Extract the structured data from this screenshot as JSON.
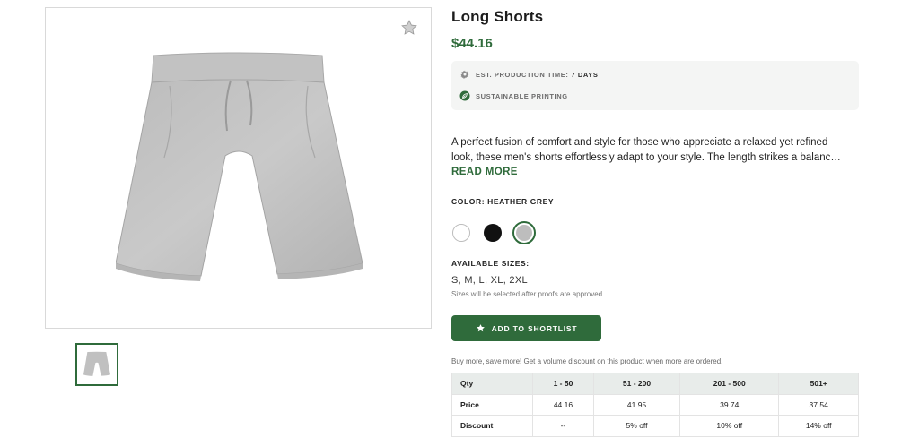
{
  "product": {
    "title": "Long Shorts",
    "price": "$44.16"
  },
  "info": {
    "production_label": "EST. PRODUCTION TIME:",
    "production_value": "7 DAYS",
    "production_icon": "gear-icon",
    "sustainable_label": "SUSTAINABLE PRINTING",
    "sustainable_icon": "leaf-icon"
  },
  "description": {
    "line1": "A perfect fusion of comfort and style for those who appreciate a relaxed yet refined",
    "line2": "look, these men's shorts effortlessly adapt to your style. The length strikes a balanc…",
    "read_more": "READ MORE"
  },
  "color": {
    "label": "COLOR: HEATHER GREY",
    "options": [
      "#ffffff",
      "#111111",
      "#bdbdbd"
    ],
    "selected_index": 2
  },
  "sizes": {
    "label": "AVAILABLE SIZES:",
    "values": "S, M, L, XL, 2XL",
    "note": "Sizes will be selected after proofs are approved"
  },
  "actions": {
    "shortlist_label": "ADD TO SHORTLIST",
    "shortlist_icon": "star-icon",
    "favorite_icon": "star-outline-icon"
  },
  "volume": {
    "note": "Buy more, save more! Get a volume discount on this product when more are ordered.",
    "headers": [
      "Qty",
      "1 - 50",
      "51 - 200",
      "201 - 500",
      "501+"
    ],
    "price_label": "Price",
    "prices": [
      "44.16",
      "41.95",
      "39.74",
      "37.54"
    ],
    "discount_label": "Discount",
    "discounts": [
      "--",
      "5% off",
      "10% off",
      "14% off"
    ]
  },
  "colors": {
    "accent": "#2f6b3b",
    "info_bg": "#f4f5f4",
    "table_header_bg": "#e8ecea"
  }
}
